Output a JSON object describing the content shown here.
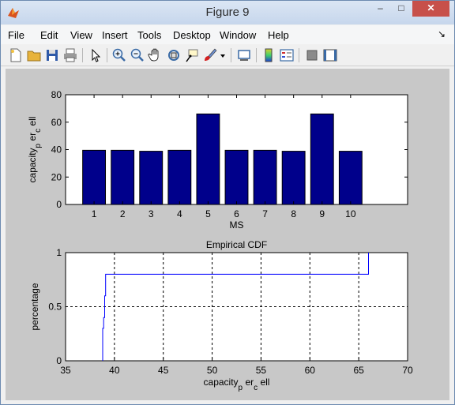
{
  "window": {
    "title": "Figure 9",
    "minimize": "–",
    "maximize": "□",
    "close": "✕"
  },
  "menu": [
    "File",
    "Edit",
    "View",
    "Insert",
    "Tools",
    "Desktop",
    "Window",
    "Help"
  ],
  "menu_arrow": "↘",
  "toolbar": {
    "icons": [
      "new-figure-icon",
      "open-file-icon",
      "save-icon",
      "print-icon",
      "edit-plot-arrow-icon",
      "zoom-in-icon",
      "zoom-out-icon",
      "pan-hand-icon",
      "rotate-3d-icon",
      "data-cursor-icon",
      "brush-icon",
      "brush-dropdown-icon",
      "link-plot-icon",
      "colorbar-icon",
      "legend-icon",
      "hide-plot-tools-icon",
      "show-plot-tools-icon"
    ]
  },
  "chart_data": [
    {
      "type": "bar",
      "title": "",
      "xlabel": "MS",
      "ylabel": "capacity_p er_c ell",
      "categories": [
        "1",
        "2",
        "3",
        "4",
        "5",
        "6",
        "7",
        "8",
        "9",
        "10"
      ],
      "values": [
        39.5,
        39.5,
        38.8,
        39.5,
        66,
        39.5,
        39.5,
        38.8,
        66,
        38.8
      ],
      "xlim": [
        0,
        12
      ],
      "ylim": [
        0,
        80
      ],
      "yticks": [
        "0",
        "20",
        "40",
        "60",
        "80"
      ],
      "bar_color": "#00008b",
      "grid": false
    },
    {
      "type": "line",
      "title": "Empirical CDF",
      "xlabel": "capacity_p er_c ell",
      "ylabel": "percentage",
      "xlim": [
        35,
        70
      ],
      "ylim": [
        0,
        1
      ],
      "xticks": [
        "35",
        "40",
        "45",
        "50",
        "55",
        "60",
        "65",
        "70"
      ],
      "yticks": [
        "0",
        "0.5",
        "1"
      ],
      "grid": true,
      "line_color": "#0000ff",
      "series": [
        {
          "x": [
            38.8,
            38.8,
            38.9,
            38.9,
            39.0,
            39.0,
            39.0,
            39.1,
            39.1,
            66.0,
            66.0
          ],
          "y": [
            0.0,
            0.3,
            0.3,
            0.4,
            0.4,
            0.5,
            0.6,
            0.6,
            0.8,
            0.8,
            1.0
          ]
        }
      ]
    }
  ]
}
